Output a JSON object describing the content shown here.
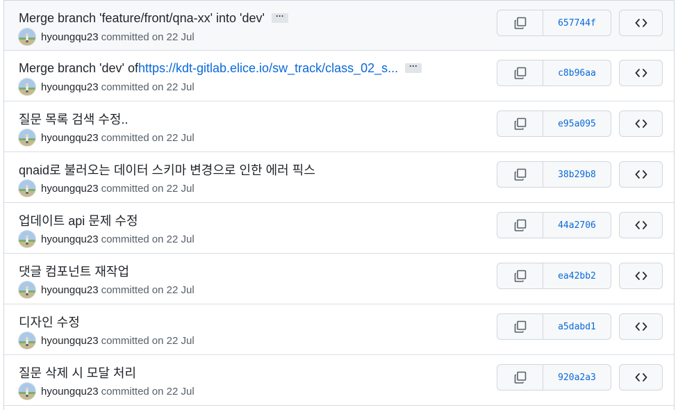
{
  "commits": [
    {
      "title": "Merge branch 'feature/front/qna-xx' into 'dev'",
      "link": "",
      "has_ellipsis": true,
      "ellipsis_label": "···",
      "author": "hyoungqu23",
      "verb": "committed",
      "date": "on 22 Jul",
      "sha": "657744f"
    },
    {
      "title": "Merge branch 'dev' of ",
      "link": "https://kdt-gitlab.elice.io/sw_track/class_02_s...",
      "has_ellipsis": true,
      "ellipsis_label": "···",
      "author": "hyoungqu23",
      "verb": "committed",
      "date": "on 22 Jul",
      "sha": "c8b96aa"
    },
    {
      "title": "질문 목록 검색 수정..",
      "link": "",
      "has_ellipsis": false,
      "ellipsis_label": "",
      "author": "hyoungqu23",
      "verb": "committed",
      "date": "on 22 Jul",
      "sha": "e95a095"
    },
    {
      "title": "qnaid로 불러오는 데이터 스키마 변경으로 인한 에러 픽스",
      "link": "",
      "has_ellipsis": false,
      "ellipsis_label": "",
      "author": "hyoungqu23",
      "verb": "committed",
      "date": "on 22 Jul",
      "sha": "38b29b8"
    },
    {
      "title": "업데이트 api 문제 수정",
      "link": "",
      "has_ellipsis": false,
      "ellipsis_label": "",
      "author": "hyoungqu23",
      "verb": "committed",
      "date": "on 22 Jul",
      "sha": "44a2706"
    },
    {
      "title": "댓글 컴포넌트 재작업",
      "link": "",
      "has_ellipsis": false,
      "ellipsis_label": "",
      "author": "hyoungqu23",
      "verb": "committed",
      "date": "on 22 Jul",
      "sha": "ea42bb2"
    },
    {
      "title": "디자인 수정",
      "link": "",
      "has_ellipsis": false,
      "ellipsis_label": "",
      "author": "hyoungqu23",
      "verb": "committed",
      "date": "on 22 Jul",
      "sha": "a5dabd1"
    },
    {
      "title": "질문 삭제 시 모달 처리",
      "link": "",
      "has_ellipsis": false,
      "ellipsis_label": "",
      "author": "hyoungqu23",
      "verb": "committed",
      "date": "on 22 Jul",
      "sha": "920a2a3"
    }
  ],
  "icons": {
    "avatar": "avatar-icon",
    "copy": "copy-icon",
    "browse": "code-icon"
  },
  "colors": {
    "link": "#0969da",
    "sha": "#0969da",
    "muted": "#57606a",
    "border": "#d0d7de",
    "button_bg": "#f6f8fa"
  }
}
